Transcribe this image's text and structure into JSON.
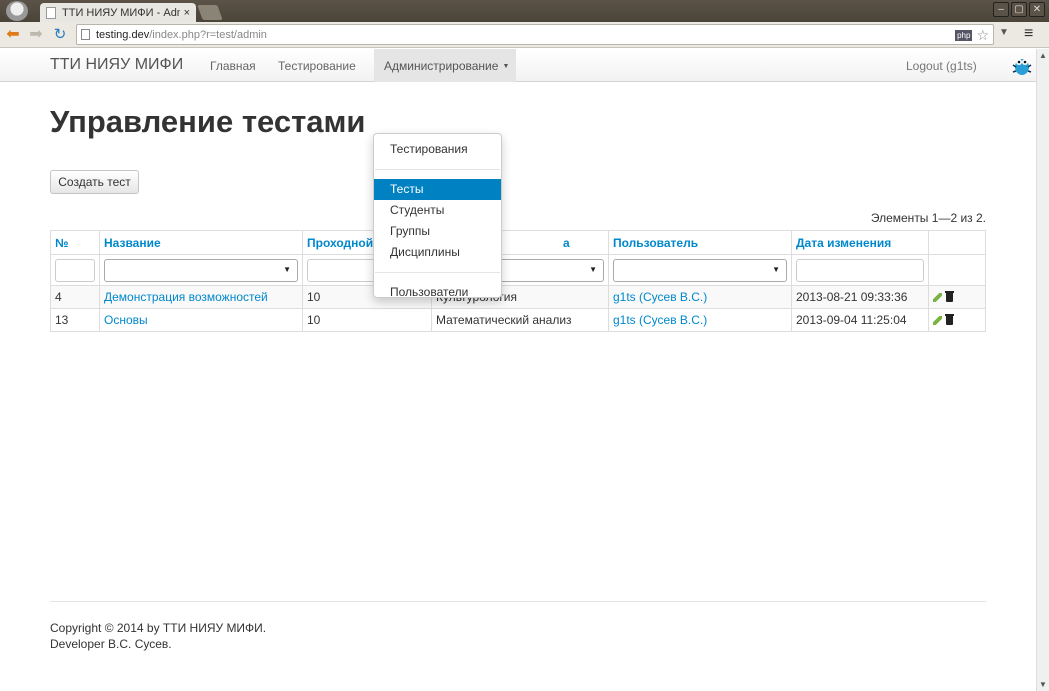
{
  "browser": {
    "tab_title": "ТТИ НИЯУ МИФИ - Adm",
    "tab_close": "×",
    "url_host": "testing.dev",
    "url_path": "/index.php?r=test/admin",
    "php_badge": "php",
    "window_buttons": [
      "–",
      "▢",
      "✕"
    ]
  },
  "navbar": {
    "brand": "ТТИ НИЯУ МИФИ",
    "home": "Главная",
    "testing": "Тестирование",
    "admin": "Администрирование",
    "logout": "Logout (g1ts)"
  },
  "dropdown": {
    "items": [
      {
        "label": "Тестирования"
      },
      {
        "label": "Тесты",
        "active": true
      },
      {
        "label": "Студенты"
      },
      {
        "label": "Группы"
      },
      {
        "label": "Дисциплины"
      },
      {
        "label": "Пользователи"
      }
    ]
  },
  "page": {
    "title": "Управление тестами",
    "create_button": "Создать тест",
    "summary": "Элементы 1—2 из 2."
  },
  "table": {
    "headers": [
      "№",
      "Название",
      "Проходной",
      "а",
      "Пользователь",
      "Дата изменения",
      ""
    ],
    "rows": [
      {
        "id": "4",
        "name": "Демонстрация возможностей",
        "pass": "10",
        "discipline": "Культурология",
        "user": "g1ts (Сусев В.С.)",
        "date": "2013-08-21 09:33:36"
      },
      {
        "id": "13",
        "name": "Основы",
        "pass": "10",
        "discipline": "Математический анализ",
        "user": "g1ts (Сусев В.С.)",
        "date": "2013-09-04 11:25:04"
      }
    ]
  },
  "footer": {
    "copyright": "Copyright © 2014 by ТТИ НИЯУ МИФИ.",
    "developer": "Developer В.С. Сусев."
  },
  "colors": {
    "link": "#0088cc",
    "active_menu": "#0081c2"
  }
}
